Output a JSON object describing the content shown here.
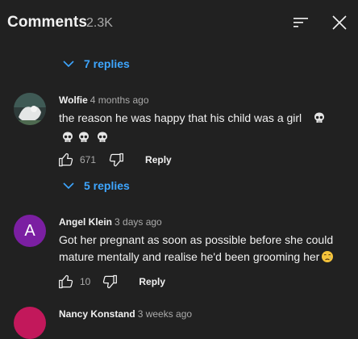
{
  "header": {
    "title": "Comments",
    "count": "2.3K"
  },
  "thread_top": {
    "replies_label": "7 replies"
  },
  "comments": [
    {
      "author": "Wolfie",
      "time": "4 months ago",
      "text": "the reason he was happy that his child was a girl",
      "emoji": "skull x4",
      "likes": "671",
      "reply_label": "Reply",
      "replies_label": "5 replies"
    },
    {
      "author": "Angel Klein",
      "avatar_letter": "A",
      "avatar_color": "#7b1fa2",
      "time": "3 days ago",
      "text": "Got her pregnant as soon as possible before she could mature mentally and realise he'd been grooming her",
      "emoji": "crying-face",
      "likes": "10",
      "reply_label": "Reply"
    },
    {
      "author": "Nancy Konstand",
      "time": "3 weeks ago",
      "avatar_color": "#c2185b"
    }
  ],
  "colors": {
    "background": "#212121",
    "link": "#3ea6ff",
    "secondary_text": "#aaaaaa"
  }
}
